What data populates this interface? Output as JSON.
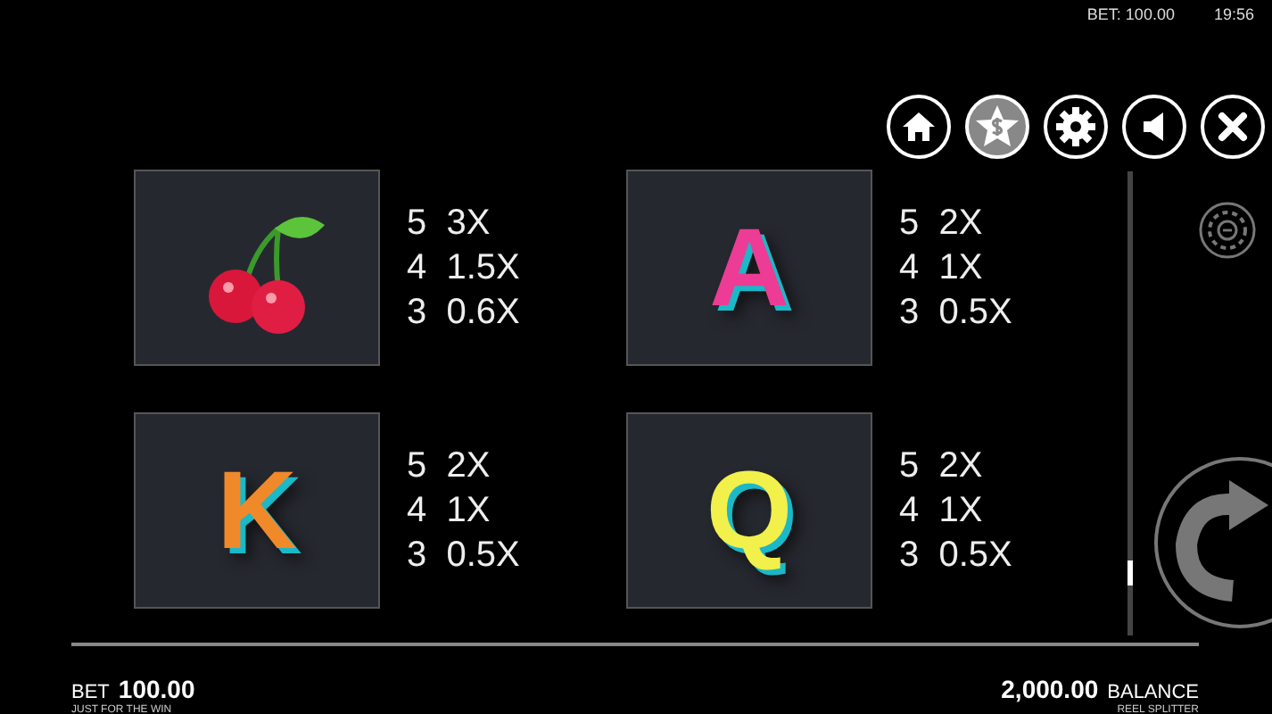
{
  "status_bar": {
    "bet": "BET: 100.00",
    "time": "19:56"
  },
  "symbols": [
    {
      "kind": "cherry",
      "pays": [
        {
          "count": "5",
          "multiplier": "3X"
        },
        {
          "count": "4",
          "multiplier": "1.5X"
        },
        {
          "count": "3",
          "multiplier": "0.6X"
        }
      ]
    },
    {
      "kind": "letter",
      "letter": "A",
      "color": "#ec3c95",
      "pays": [
        {
          "count": "5",
          "multiplier": "2X"
        },
        {
          "count": "4",
          "multiplier": "1X"
        },
        {
          "count": "3",
          "multiplier": "0.5X"
        }
      ]
    },
    {
      "kind": "letter",
      "letter": "K",
      "color": "#f0892a",
      "pays": [
        {
          "count": "5",
          "multiplier": "2X"
        },
        {
          "count": "4",
          "multiplier": "1X"
        },
        {
          "count": "3",
          "multiplier": "0.5X"
        }
      ]
    },
    {
      "kind": "letter",
      "letter": "Q",
      "color": "#f2f04a",
      "pays": [
        {
          "count": "5",
          "multiplier": "2X"
        },
        {
          "count": "4",
          "multiplier": "1X"
        },
        {
          "count": "3",
          "multiplier": "0.5X"
        }
      ]
    }
  ],
  "footer": {
    "bet_label": "BET",
    "bet_value": "100.00",
    "bet_sub": "JUST FOR THE WIN",
    "balance_value": "2,000.00",
    "balance_label": "BALANCE",
    "balance_sub": "REEL SPLITTER"
  }
}
